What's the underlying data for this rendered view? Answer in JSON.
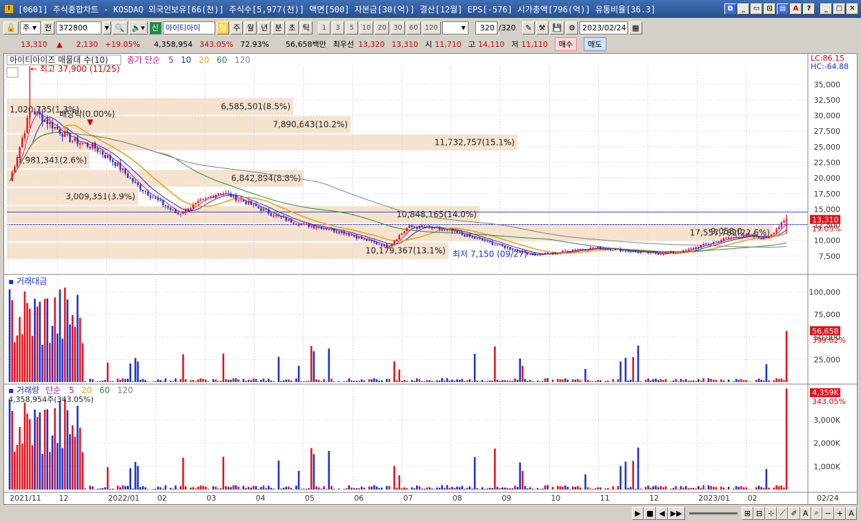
{
  "window": {
    "title": "[0601] 주식종합차트 - KOSDAQ 외국인보유[66(천)] 주식수[5,977(천)] 액면[500] 자본금[30(억)] 결산[12월] EPS[-576] 시가총액[796(억)] 유통비율[36.3]",
    "app_icon": "I"
  },
  "toolbar": {
    "period_select": "주",
    "prev_label": "전",
    "code_value": "372800",
    "new_label": "신",
    "stock_name": "아이티아이",
    "period_buttons": [
      "일",
      "주",
      "월",
      "년",
      "분",
      "초",
      "틱"
    ],
    "interval_buttons": [
      "1",
      "3",
      "5",
      "10",
      "20",
      "30",
      "60",
      "120"
    ],
    "count_value": "320",
    "count_total": "/320",
    "date_value": "2023/02/24"
  },
  "infobar": {
    "price": "13,310",
    "change_arrow": "▲",
    "change": "2,130",
    "change_pct": "+19.05%",
    "volume": "4,358,954",
    "volume_ratio": "343.05%",
    "ratio2": "72.93%",
    "amount": "56,658백만",
    "best_label": "최우선",
    "ask": "13,320",
    "bid": "13,310",
    "open_label": "시",
    "open": "11,710",
    "high_label": "고",
    "high": "14,110",
    "low_label": "저",
    "low": "11,110",
    "buy_label": "매수",
    "sell_label": "매도"
  },
  "chart": {
    "price_legend_title": "아이티아이즈 매물대 수(10)",
    "ma_legend_title": "종가 단순",
    "ma_periods": [
      "5",
      "10",
      "20",
      "60",
      "120"
    ],
    "ma_colors": [
      "#c0139b",
      "#1a2fbf",
      "#e8a31a",
      "#1f8a3a",
      "#808080"
    ],
    "lc_label": "LC:86.15",
    "hc_label": "HC:-64.88",
    "annot_high": "최고 37,900 (11/25)",
    "annot_low": "최저 7,150 (09/27)",
    "annot_rights": "배당락(0.00%)",
    "current_price": "13,310",
    "current_pct": "19.05%",
    "price_ticks": [
      "35,000",
      "32,500",
      "30,000",
      "27,500",
      "25,000",
      "22,500",
      "20,000",
      "17,500",
      "15,000",
      "12,500",
      "10,000",
      "7,500"
    ],
    "vol_profile": [
      "6,585,501(8.5%)",
      "7,890,643(10.2%)",
      "11,732,757(15.1%)",
      "1,020,735(1.3%)",
      "1,981,341(2.6%)",
      "6,842,894(8.8%)",
      "3,009,351(3.9%)",
      "10,848,165(14.0%)",
      "17,557,782(22.6%)",
      "배당락(0.00%)",
      "9,058,0…",
      "10,179,367(13.1%)"
    ],
    "amount_title": "거래대금",
    "amount_ticks": [
      "100,000",
      "75,000",
      "50,000",
      "25,000"
    ],
    "amount_current": "56,658",
    "amount_pct": "399.62%",
    "volume_title": "거래량",
    "volume_ma_title": "단순",
    "volume_ma_periods": [
      "5",
      "20",
      "60",
      "120"
    ],
    "volume_current_text": "4,358,954주(343.05%)",
    "volume_ticks": [
      "3,000K",
      "2,000K",
      "1,000K"
    ],
    "volume_current": "4,359K",
    "volume_pct": "343.05%",
    "date_ticks": [
      "2021/11",
      "12",
      "2022/01",
      "02",
      "03",
      "04",
      "05",
      "06",
      "07",
      "08",
      "09",
      "10",
      "11",
      "12",
      "2023/01",
      "02"
    ],
    "last_date": "02/24"
  },
  "chart_data": {
    "type": "candlestick",
    "title": "",
    "x_labels": [
      "2021/11",
      "12",
      "2022/01",
      "02",
      "03",
      "04",
      "05",
      "06",
      "07",
      "08",
      "09",
      "10",
      "11",
      "12",
      "2023/01",
      "02",
      "02/24"
    ],
    "y_range": [
      5000,
      37900
    ],
    "series": [
      {
        "name": "close_trend",
        "values": [
          19500,
          31000,
          28500,
          26000,
          25000,
          22500,
          19000,
          16500,
          14200,
          16000,
          17800,
          16500,
          15000,
          13500,
          12500,
          12000,
          11200,
          10000,
          9000,
          12200,
          12000,
          11500,
          10500,
          9500,
          8500,
          7700,
          8000,
          8600,
          8800,
          8500,
          8100,
          7900,
          8200,
          9200,
          10200,
          10800,
          10300,
          13310
        ]
      }
    ],
    "colors": {
      "up": "#e8101a",
      "down": "#1a2fcf"
    }
  },
  "statusbar": {
    "nav_buttons": [
      "▶",
      "■",
      "◀",
      "▶▶"
    ]
  }
}
